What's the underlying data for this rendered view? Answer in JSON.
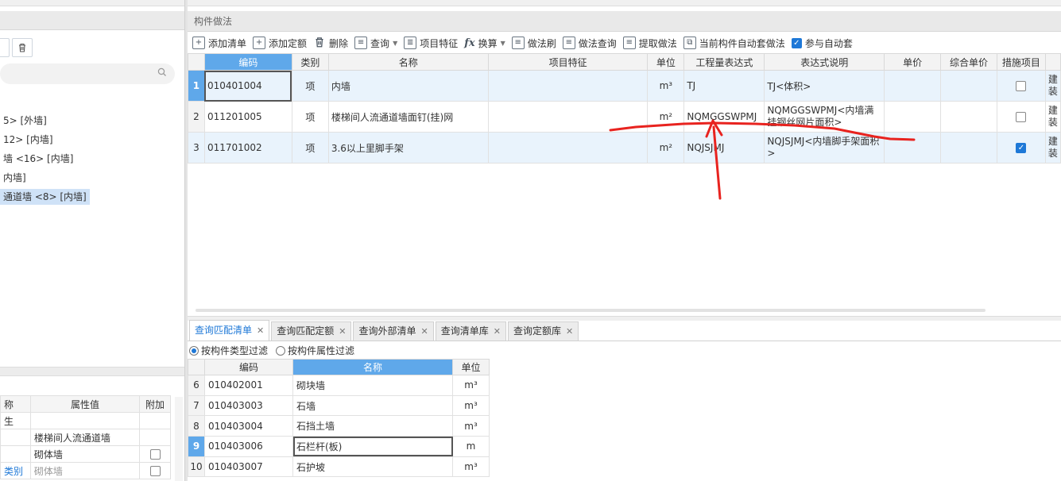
{
  "left": {
    "tree": [
      {
        "label": "5> [外墙]"
      },
      {
        "label": "12> [内墙]"
      },
      {
        "label": "墙 <16> [内墙]"
      },
      {
        "label": "内墙]"
      },
      {
        "label": "通道墙 <8> [内墙]"
      }
    ],
    "props": {
      "headers": [
        "称",
        "属性值",
        "附加"
      ],
      "rows": [
        {
          "name": "生",
          "value": "",
          "extra": false,
          "has_cb": false
        },
        {
          "name": "",
          "value": "楼梯间人流通道墙",
          "extra": false,
          "has_cb": false
        },
        {
          "name": "",
          "value": "砌体墙",
          "extra": false,
          "has_cb": true
        },
        {
          "name": "类别",
          "value": "砌体墙",
          "extra": false,
          "has_cb": true
        }
      ]
    }
  },
  "panel": {
    "title": "构件做法",
    "toolbar": [
      {
        "label": "添加清单",
        "icon": "add-list-icon"
      },
      {
        "label": "添加定额",
        "icon": "add-quota-icon"
      },
      {
        "label": "删除",
        "icon": "trash-icon"
      },
      {
        "label": "查询",
        "icon": "query-icon",
        "caret": true
      },
      {
        "label": "项目特征",
        "icon": "feature-icon"
      },
      {
        "label": "换算",
        "icon": "fx-icon",
        "caret": true
      },
      {
        "label": "做法刷",
        "icon": "brush-icon"
      },
      {
        "label": "做法查询",
        "icon": "method-query-icon"
      },
      {
        "label": "提取做法",
        "icon": "extract-icon"
      },
      {
        "label": "当前构件自动套做法",
        "icon": "auto-apply-icon"
      },
      {
        "label": "参与自动套",
        "icon": "checkbox-icon",
        "checked": true
      }
    ],
    "columns": [
      "编码",
      "类别",
      "名称",
      "项目特征",
      "单位",
      "工程量表达式",
      "表达式说明",
      "单价",
      "综合单价",
      "措施项目"
    ],
    "rows": [
      {
        "num": "1",
        "code": "010401004",
        "type": "项",
        "name": "内墙",
        "feature": "",
        "unit": "m³",
        "expr": "TJ",
        "desc": "TJ<体积>",
        "price": "",
        "total": "",
        "measure": false,
        "extra": "建装"
      },
      {
        "num": "2",
        "code": "011201005",
        "type": "项",
        "name": "楼梯间人流通道墙面钉(挂)网",
        "feature": "",
        "unit": "m²",
        "expr": "NQMGGSWPMJ",
        "desc": "NQMGGSWPMJ<内墙满挂钢丝网片面积>",
        "price": "",
        "total": "",
        "measure": false,
        "extra": "建装"
      },
      {
        "num": "3",
        "code": "011701002",
        "type": "项",
        "name": "3.6以上里脚手架",
        "feature": "",
        "unit": "m²",
        "expr": "NQJSJMJ",
        "desc": "NQJSJMJ<内墙脚手架面积>",
        "price": "",
        "total": "",
        "measure": true,
        "extra": "建装"
      }
    ]
  },
  "bottom": {
    "tabs": [
      "查询匹配清单",
      "查询匹配定额",
      "查询外部清单",
      "查询清单库",
      "查询定额库"
    ],
    "filters": [
      "按构件类型过滤",
      "按构件属性过滤"
    ],
    "columns": [
      "编码",
      "名称",
      "单位"
    ],
    "rows": [
      {
        "num": "6",
        "code": "010402001",
        "name": "砌块墙",
        "unit": "m³"
      },
      {
        "num": "7",
        "code": "010403003",
        "name": "石墙",
        "unit": "m³"
      },
      {
        "num": "8",
        "code": "010403004",
        "name": "石挡土墙",
        "unit": "m³"
      },
      {
        "num": "9",
        "code": "010403006",
        "name": "石栏杆(板)",
        "unit": "m"
      },
      {
        "num": "10",
        "code": "010403007",
        "name": "石护坡",
        "unit": "m³"
      }
    ]
  },
  "colors": {
    "accent": "#1e78d7",
    "selected_header": "#5fa8ea",
    "annotation": "#e8231f"
  }
}
